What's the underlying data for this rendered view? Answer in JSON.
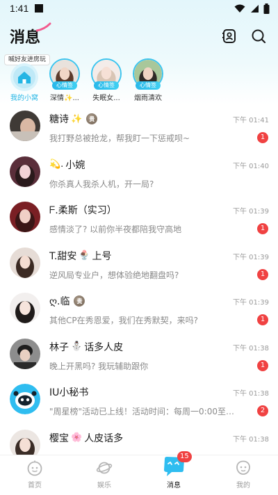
{
  "status_bar": {
    "time": "1:41"
  },
  "header": {
    "title": "消息"
  },
  "stories": {
    "tip": "喊好友进房玩",
    "my_room_label": "我的小窝",
    "items": [
      {
        "name": "深情✨...",
        "badge": "心情签"
      },
      {
        "name": "失眠女...",
        "badge": "心情签"
      },
      {
        "name": "烟雨清欢",
        "badge": "心情签"
      }
    ]
  },
  "conversations": [
    {
      "name": "糖诗",
      "emoji": "✨",
      "vip": true,
      "preview": "我打野总被抢龙，帮我盯一下惩戒呗~",
      "time": "下午 01:41",
      "unread": "1"
    },
    {
      "name": "小婉",
      "emoji": "💫.",
      "emoji_prefix": true,
      "vip": false,
      "preview": "你杀真人我杀人机，开一局?",
      "time": "下午 01:40",
      "unread": ""
    },
    {
      "name": "ᖴ.柔斯（实习）",
      "emoji": "",
      "vip": false,
      "preview": "感情淡了? 以前你半夜都陪我守高地",
      "time": "下午 01:39",
      "unread": "1"
    },
    {
      "name": "T.甜安",
      "emoji": "🍨",
      "suffix": "上号",
      "vip": false,
      "preview": "逆风局专业户，想体验绝地翻盘吗?",
      "time": "下午 01:39",
      "unread": "1"
    },
    {
      "name": "ღ.临",
      "emoji": "",
      "vip": true,
      "preview": "其他CP在秀恩爱，我们在秀默契，来吗?",
      "time": "下午 01:39",
      "unread": "1"
    },
    {
      "name": "林子",
      "emoji": "⛄",
      "suffix": "话多人皮",
      "vip": false,
      "preview": "晚上开黑吗? 我玩辅助跟你",
      "time": "下午 01:38",
      "unread": "1"
    },
    {
      "name": "IU小秘书",
      "emoji": "",
      "vip": false,
      "preview": "\"周星榜\"活动已上线！活动时间：每周一0:00至周...",
      "time": "下午 01:38",
      "unread": "2"
    },
    {
      "name": "樱宝",
      "emoji": "🌸",
      "suffix": "人皮话多",
      "vip": false,
      "preview": "",
      "time": "下午 01:38",
      "unread": ""
    }
  ],
  "vip_badge_text": "贵",
  "bottom_nav": {
    "items": [
      {
        "label": "首页"
      },
      {
        "label": "娱乐"
      },
      {
        "label": "消息",
        "badge": "15"
      },
      {
        "label": "我的"
      }
    ]
  },
  "colors": {
    "accent": "#23b5e4",
    "unread": "#f04242",
    "title_swoosh": "#f25a8e"
  },
  "icons": [
    "signal-icon",
    "wifi-icon",
    "battery-icon",
    "contacts-icon",
    "search-icon",
    "home-icon",
    "heart-icon",
    "galaxy-icon",
    "chat-icon",
    "profile-icon"
  ]
}
